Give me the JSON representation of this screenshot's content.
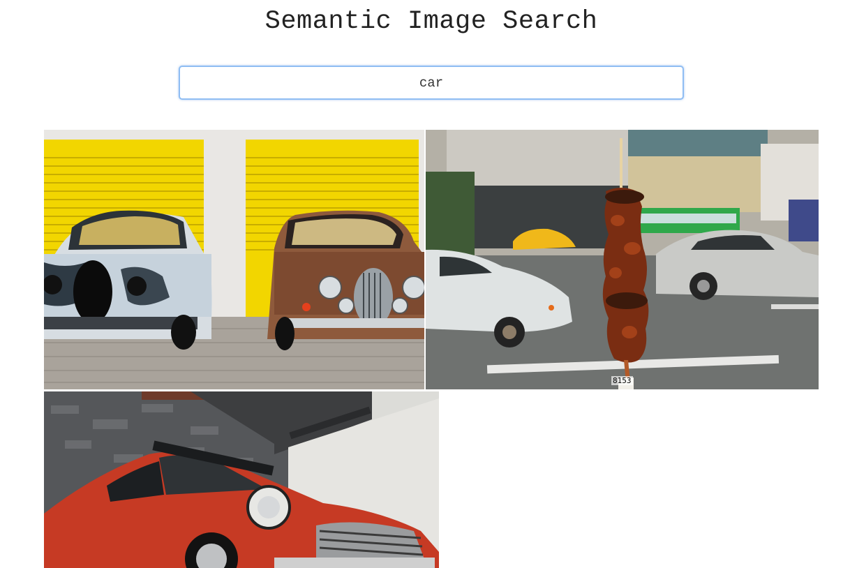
{
  "header": {
    "title": "Semantic Image Search"
  },
  "search": {
    "value": "car"
  },
  "results": [
    {
      "description": "two vintage cars in front of yellow garage doors"
    },
    {
      "description": "street scene with meat skewer in foreground",
      "label": "8153"
    },
    {
      "description": "red mini cooper under stone building"
    }
  ]
}
